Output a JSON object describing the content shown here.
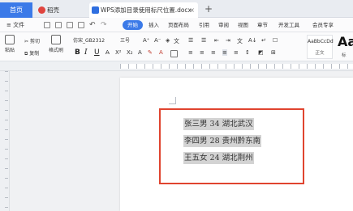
{
  "tabs": {
    "home": "首页",
    "tab1": "稻壳",
    "tab2": "WPS添加目录使用标尺位置.docx",
    "new_tab_icon": "plus-icon"
  },
  "menu": {
    "file": "≡ 文件",
    "items": [
      "开始",
      "插入",
      "页面布局",
      "引用",
      "审阅",
      "视图",
      "章节",
      "开发工具",
      "会员专享"
    ],
    "active": "开始"
  },
  "ribbon": {
    "paste": "粘贴",
    "cut": "剪切",
    "copy": "复制",
    "format_painter": "格式刷",
    "font_name": "仿宋_GB2312",
    "font_size": "三号",
    "bold": "B",
    "italic": "I",
    "underline": "U",
    "style_normal_preview": "AaBbCcDd",
    "style_normal_label": "正文",
    "style_heading_preview": "Aa",
    "style_heading_label": "标"
  },
  "document": {
    "lines": [
      "张三男 34 湖北武汉",
      "李四男 28 贵州黔东南",
      "王五女 24 湖北荆州"
    ],
    "selection_color": "#d3d3d3",
    "frame_color": "#e0442f"
  },
  "colors": {
    "accent": "#3b7ae8"
  }
}
